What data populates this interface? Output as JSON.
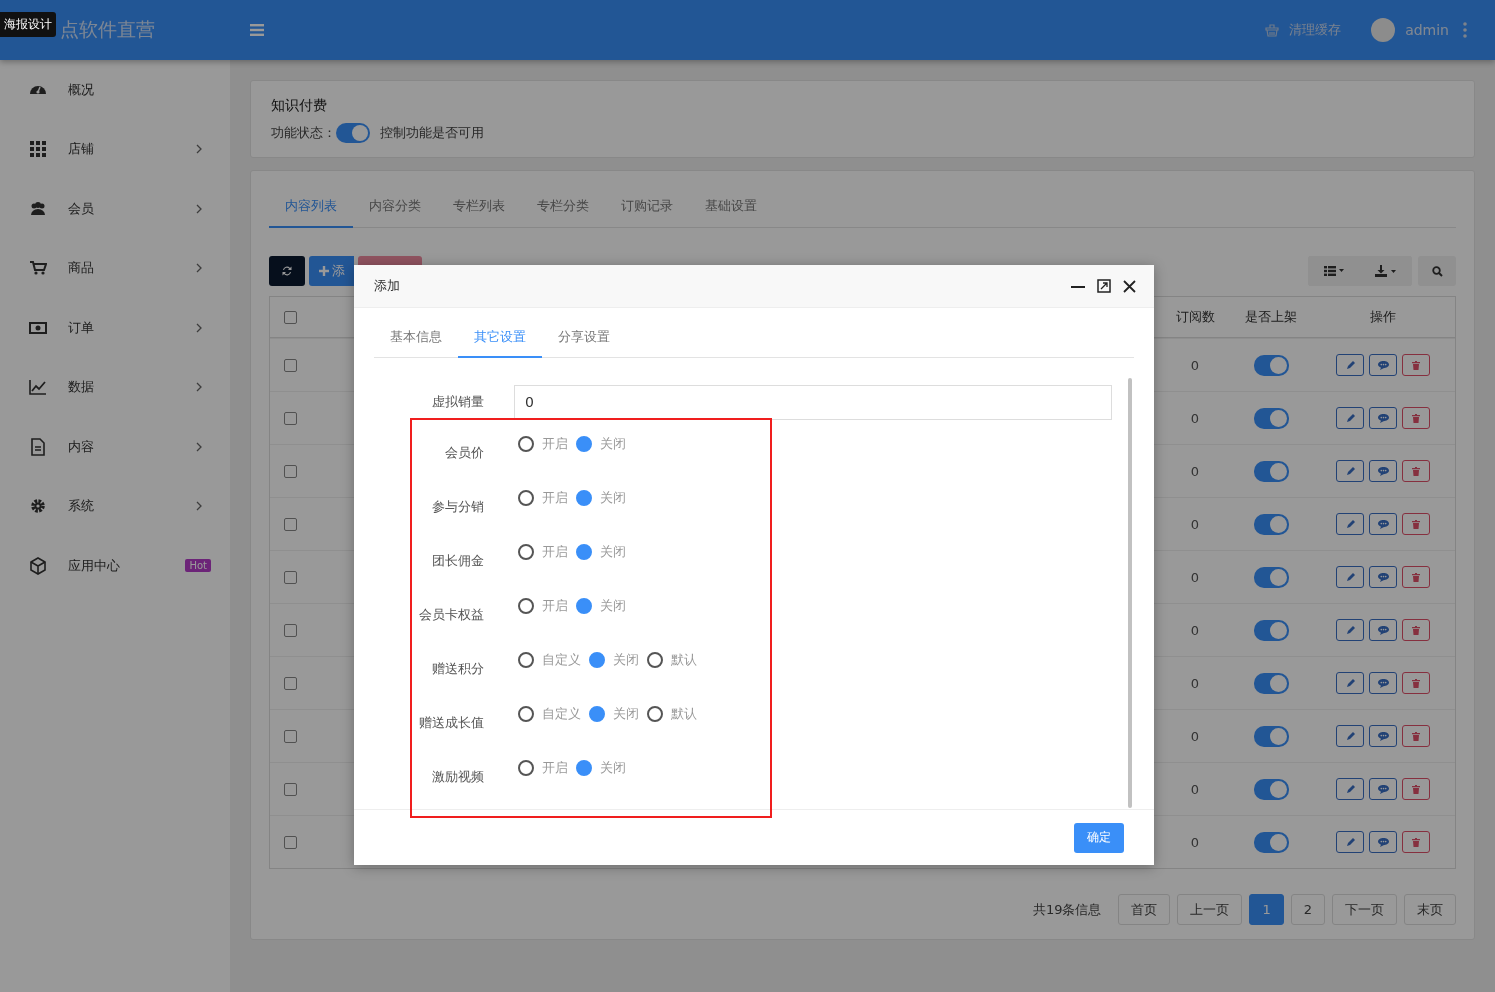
{
  "header": {
    "tooltip": "海报设计",
    "title": "点软件直营",
    "clear_cache": "清理缓存",
    "user": "admin"
  },
  "sidebar": {
    "items": [
      {
        "label": "概况",
        "expandable": false
      },
      {
        "label": "店铺",
        "expandable": true
      },
      {
        "label": "会员",
        "expandable": true
      },
      {
        "label": "商品",
        "expandable": true
      },
      {
        "label": "订单",
        "expandable": true
      },
      {
        "label": "数据",
        "expandable": true
      },
      {
        "label": "内容",
        "expandable": true
      },
      {
        "label": "系统",
        "expandable": true
      },
      {
        "label": "应用中心",
        "expandable": false,
        "badge": "Hot"
      }
    ]
  },
  "feature": {
    "title": "知识付费",
    "status_label": "功能状态：",
    "on": true,
    "hint": "控制功能是否可用"
  },
  "tabs": [
    {
      "label": "内容列表",
      "selected": true
    },
    {
      "label": "内容分类",
      "selected": false
    },
    {
      "label": "专栏列表",
      "selected": false
    },
    {
      "label": "专栏分类",
      "selected": false
    },
    {
      "label": "订购记录",
      "selected": false
    },
    {
      "label": "基础设置",
      "selected": false
    }
  ],
  "toolbar": {
    "add": "添"
  },
  "table": {
    "all_checked": false,
    "columns": [
      "订阅数",
      "是否上架",
      "操作"
    ],
    "rows": [
      {
        "checked": false,
        "subscriptions": "0",
        "listed": true
      },
      {
        "checked": false,
        "subscriptions": "0",
        "listed": true
      },
      {
        "checked": false,
        "subscriptions": "0",
        "listed": true
      },
      {
        "checked": false,
        "subscriptions": "0",
        "listed": true
      },
      {
        "checked": false,
        "subscriptions": "0",
        "listed": true
      },
      {
        "checked": false,
        "subscriptions": "0",
        "listed": true
      },
      {
        "checked": false,
        "subscriptions": "0",
        "listed": true
      },
      {
        "checked": false,
        "subscriptions": "0",
        "listed": true
      },
      {
        "checked": false,
        "subscriptions": "0",
        "listed": true
      },
      {
        "checked": false,
        "subscriptions": "0",
        "listed": true
      }
    ]
  },
  "pagination": {
    "summary": "共19条信息",
    "pages": [
      {
        "label": "首页",
        "selected": false
      },
      {
        "label": "上一页",
        "selected": false
      },
      {
        "label": "1",
        "selected": true
      },
      {
        "label": "2",
        "selected": false
      },
      {
        "label": "下一页",
        "selected": false
      },
      {
        "label": "末页",
        "selected": false
      }
    ]
  },
  "modal": {
    "title": "添加",
    "tabs": [
      {
        "label": "基本信息",
        "selected": false
      },
      {
        "label": "其它设置",
        "selected": true
      },
      {
        "label": "分享设置",
        "selected": false
      }
    ],
    "fields": [
      {
        "kind": "text",
        "label": "虚拟销量",
        "value": "0"
      },
      {
        "kind": "radio",
        "label": "会员价",
        "options": [
          {
            "label": "开启",
            "selected": false
          },
          {
            "label": "关闭",
            "selected": true
          }
        ]
      },
      {
        "kind": "radio",
        "label": "参与分销",
        "options": [
          {
            "label": "开启",
            "selected": false
          },
          {
            "label": "关闭",
            "selected": true
          }
        ]
      },
      {
        "kind": "radio",
        "label": "团长佣金",
        "options": [
          {
            "label": "开启",
            "selected": false
          },
          {
            "label": "关闭",
            "selected": true
          }
        ]
      },
      {
        "kind": "radio",
        "label": "会员卡权益",
        "options": [
          {
            "label": "开启",
            "selected": false
          },
          {
            "label": "关闭",
            "selected": true
          }
        ]
      },
      {
        "kind": "radio",
        "label": "赠送积分",
        "options": [
          {
            "label": "自定义",
            "selected": false
          },
          {
            "label": "关闭",
            "selected": true
          },
          {
            "label": "默认",
            "selected": false
          }
        ]
      },
      {
        "kind": "radio",
        "label": "赠送成长值",
        "options": [
          {
            "label": "自定义",
            "selected": false
          },
          {
            "label": "关闭",
            "selected": true
          },
          {
            "label": "默认",
            "selected": false
          }
        ]
      },
      {
        "kind": "radio",
        "label": "激励视频",
        "options": [
          {
            "label": "开启",
            "selected": false
          },
          {
            "label": "关闭",
            "selected": true
          }
        ]
      }
    ],
    "confirm": "确定"
  }
}
